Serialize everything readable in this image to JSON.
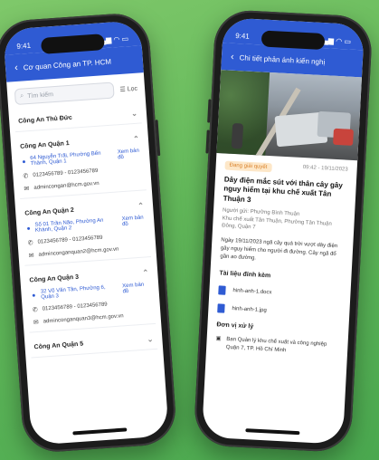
{
  "left_phone": {
    "status_time": "9:41",
    "status_icons": "▂▄▆ ◠ ▭",
    "appbar_title": "Cơ quan Công an TP. HCM",
    "search": {
      "placeholder": "Tìm kiếm"
    },
    "filter_label": "Lọc",
    "cards": [
      {
        "title": "Công An Thủ Đức"
      },
      {
        "title": "Công An Quận 1",
        "address": "64 Nguyễn Trãi, Phường Bến Thành, Quận 1",
        "map_link": "Xem bản đồ",
        "phone": "0123456789 - 0123456789",
        "email": "admincongan@hcm.gov.vn"
      },
      {
        "title": "Công An Quận 2",
        "address": "Số 01 Trần Não, Phường An Khánh, Quận 2",
        "map_link": "Xem bản đồ",
        "phone": "0123456789 - 0123456789",
        "email": "adminconganquan2@hcm.gov.vn"
      },
      {
        "title": "Công An Quận 3",
        "address": "32 Võ Văn Tần, Phường 6, Quận 3",
        "map_link": "Xem bản đồ",
        "phone": "0123456789 - 0123456789",
        "email": "adminconganquan3@hcm.gov.vn"
      },
      {
        "title": "Công An Quận 5"
      }
    ]
  },
  "right_phone": {
    "status_time": "9:41",
    "status_icons": "▂▄▆ ◠ ▭",
    "appbar_title": "Chi tiết phản ánh kiến nghị",
    "badge": "Đang giải quyết",
    "date": "09:42 - 19/11/2023",
    "title": "Dây điện mắc sút với thân cây gây nguy hiểm tại khu chế xuất Tân Thuận 3",
    "author": "Người gửi: Phường Bình Thuận",
    "location": "Khu chế xuất Tân Thuận, Phường Tân Thuận Đông, Quận 7",
    "body": "Ngày 19/11/2023 ngã cây quá trời vượt dây điện gây nguy hiểm cho người đi đường. Cây ngã đổ gần ao đường.",
    "attachments_label": "Tài liệu đính kèm",
    "attachments": [
      "hinh-anh-1.docx",
      "hinh-anh-1.jpg"
    ],
    "unit_label": "Đơn vị xử lý",
    "unit_text": "Ban Quản lý khu chế xuất và công nghiệp Quận 7, TP. Hồ Chí Minh"
  },
  "colors": {
    "primary": "#2f5bd3",
    "badge_bg": "#fde7c8",
    "badge_text": "#d9822b",
    "background": "#62b85a"
  }
}
